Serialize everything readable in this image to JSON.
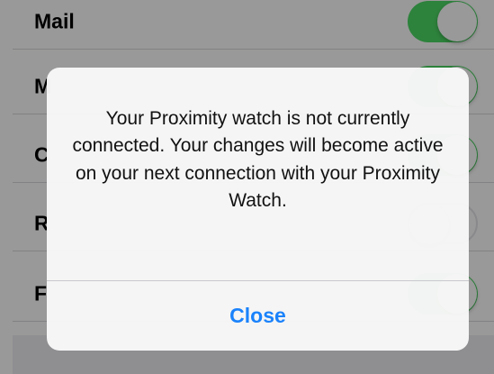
{
  "settings": {
    "rows": [
      {
        "label": "Mail",
        "toggle": "on"
      },
      {
        "label": "M",
        "toggle": "on"
      },
      {
        "label": "C",
        "toggle": "on"
      },
      {
        "label": "R",
        "toggle": "off"
      },
      {
        "label": "F",
        "toggle": "on"
      }
    ]
  },
  "alert": {
    "message": "Your Proximity watch is not currently connected. Your changes will become active on your next connection with your Proximity Watch.",
    "button_label": "Close"
  },
  "colors": {
    "toggle_on": "#4cd964",
    "button_text": "#1a82fb",
    "overlay": "rgba(0,0,0,0.40)"
  }
}
